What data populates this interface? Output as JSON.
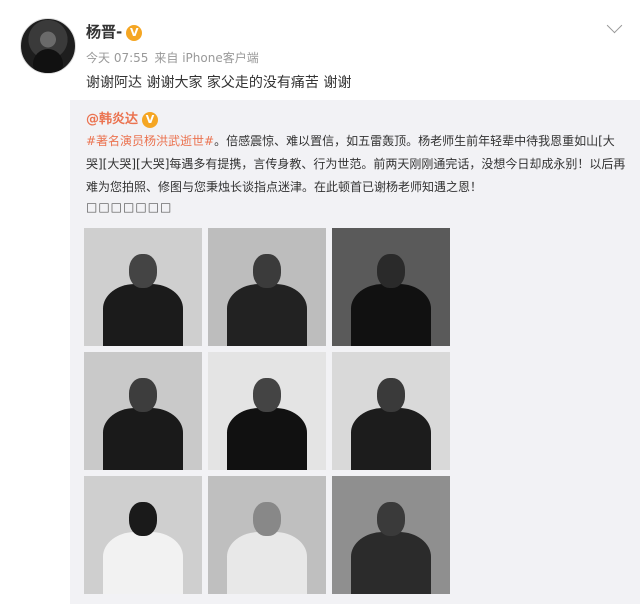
{
  "post": {
    "username": "杨晋-",
    "verified_badge": "V",
    "time": "今天 07:55",
    "source": "来自 iPhone客户端",
    "text": "谢谢阿达 谢谢大家 家父走的没有痛苦 谢谢",
    "icons": [
      "avatar",
      "verified-badge-icon",
      "chevron-down-icon"
    ]
  },
  "repost": {
    "username": "@韩炎达",
    "verified_badge": "V",
    "hashtag": "#著名演员杨洪武逝世#",
    "text": "。倍感震惊、难以置信，如五雷轰顶。杨老师生前年轻辈中待我恩重如山[大哭][大哭][大哭]每遇多有提携，言传身教、行为世范。前两天刚刚通完话，没想今日却成永别！以后再难为您拍照、修图与您秉烛长谈指点迷津。在此顿首已谢杨老师知遇之恩！",
    "boxes": "□□□□□□□",
    "photos": [
      {
        "tone": "#cfcfcf",
        "head": "#444",
        "body": "#1b1b1b"
      },
      {
        "tone": "#bdbdbd",
        "head": "#3b3b3b",
        "body": "#222"
      },
      {
        "tone": "#5a5a5a",
        "head": "#2a2a2a",
        "body": "#111"
      },
      {
        "tone": "#c9c9c9",
        "head": "#3d3d3d",
        "body": "#1a1a1a"
      },
      {
        "tone": "#e4e4e4",
        "head": "#444",
        "body": "#111"
      },
      {
        "tone": "#d9d9d9",
        "head": "#3a3a3a",
        "body": "#1c1c1c"
      },
      {
        "tone": "#cfcfcf",
        "head": "#1a1a1a",
        "body": "#f2f2f2"
      },
      {
        "tone": "#bfbfbf",
        "head": "#888",
        "body": "#e8e8e8"
      },
      {
        "tone": "#8f8f8f",
        "head": "#3a3a3a",
        "body": "#2b2b2b"
      }
    ]
  }
}
